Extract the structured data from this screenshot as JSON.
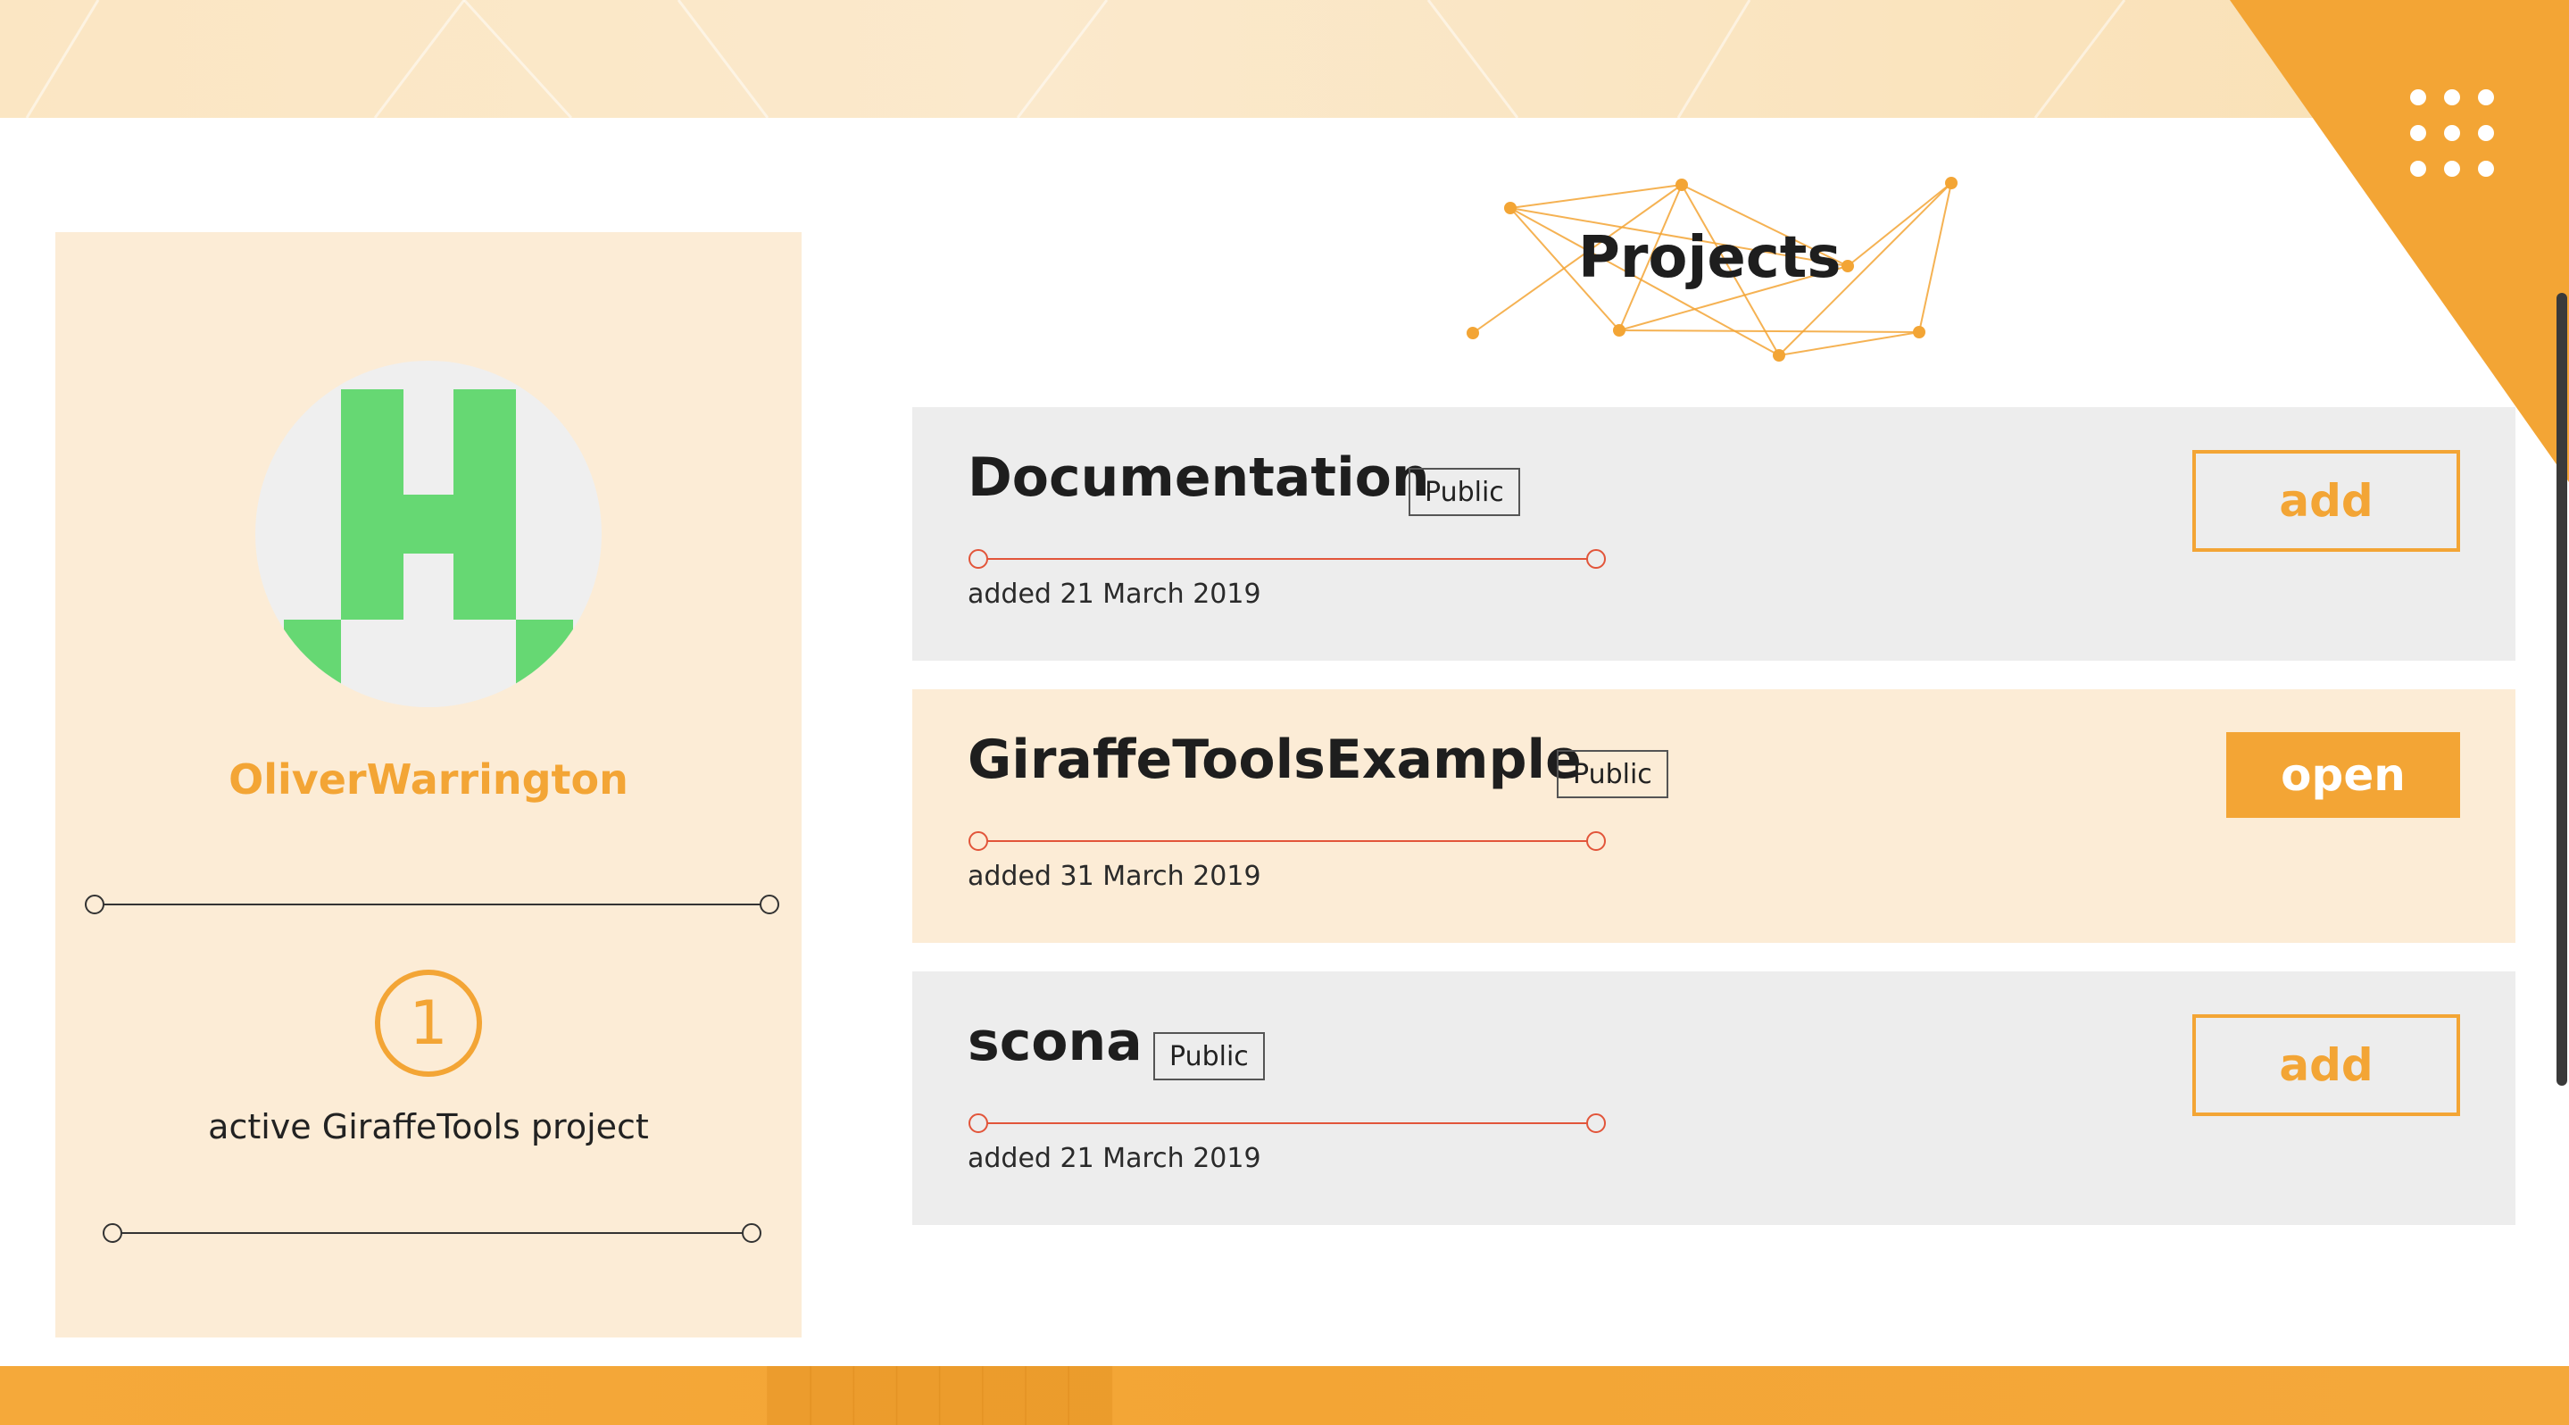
{
  "colors": {
    "accent": "#f3a535",
    "cream": "#fcecd6",
    "card_grey": "#ededed",
    "avatar_green": "#66d873",
    "timeline_red": "#e2553a"
  },
  "header": {
    "apps_icon": "grid-dots-icon"
  },
  "profile": {
    "avatar_icon": "letter-h-avatar-icon",
    "username": "OliverWarrington",
    "active_count": "1",
    "active_label": "active GiraffeTools project"
  },
  "main": {
    "title": "Projects",
    "projects": [
      {
        "name": "Documentation",
        "visibility": "Public",
        "added": "added 21 March 2019",
        "action": "add"
      },
      {
        "name": "GiraffeToolsExample",
        "visibility": "Public",
        "added": "added 31 March 2019",
        "action": "open"
      },
      {
        "name": "scona",
        "visibility": "Public",
        "added": "added 21 March 2019",
        "action": "add"
      }
    ]
  }
}
